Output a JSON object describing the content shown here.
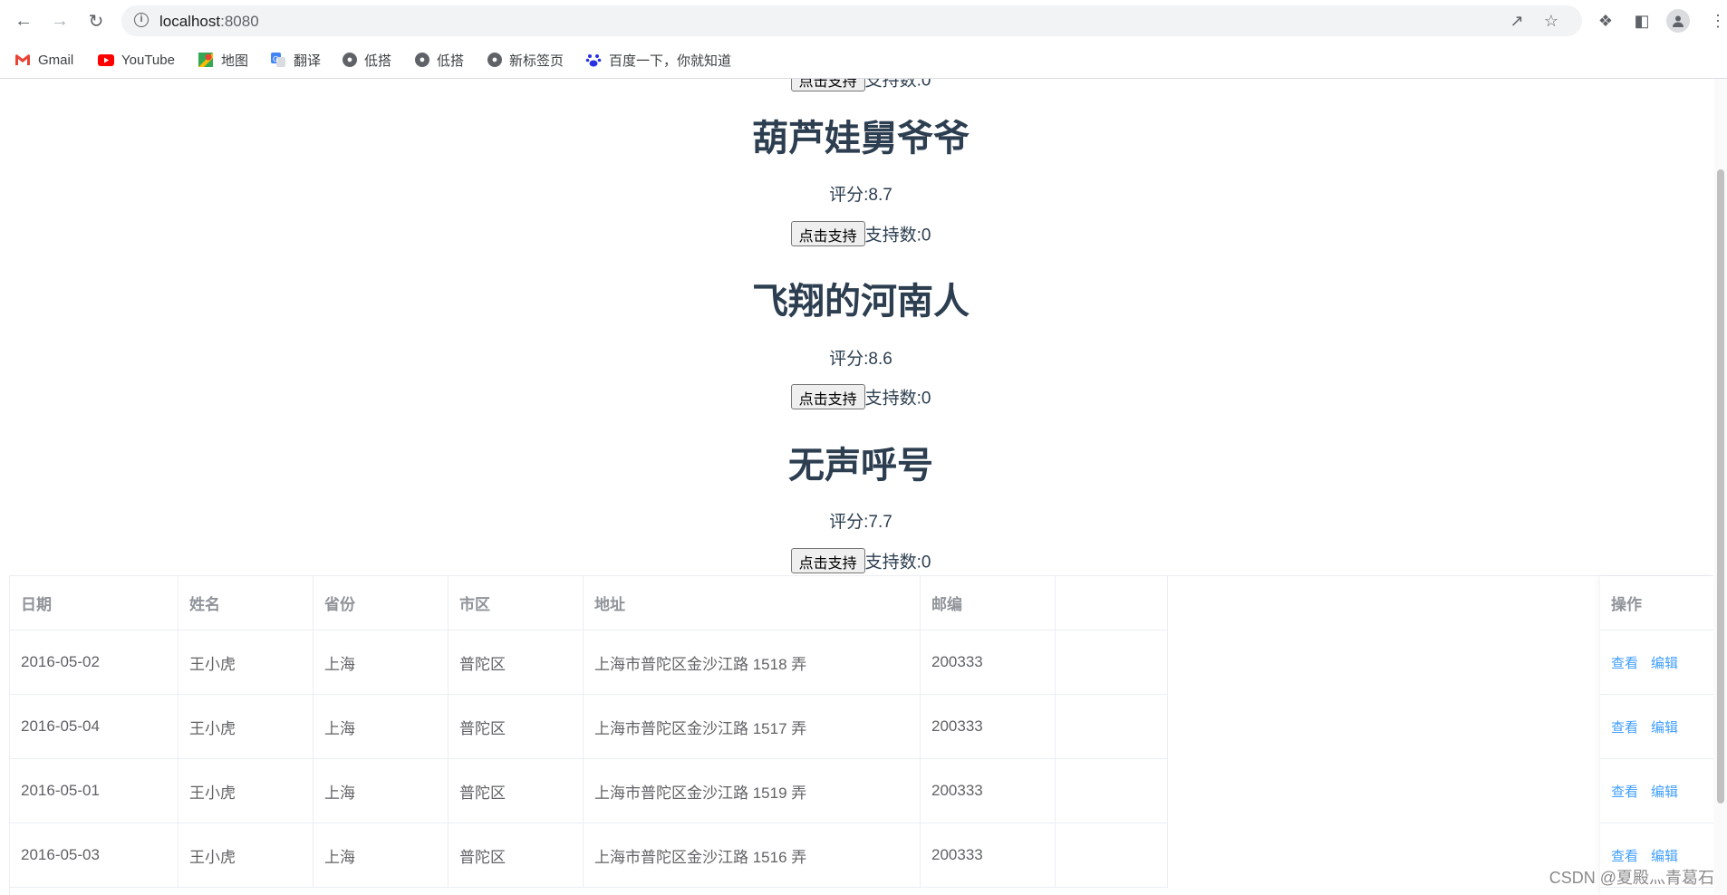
{
  "browser": {
    "url_host": "localhost",
    "url_port": ":8080",
    "bookmarks": [
      "Gmail",
      "YouTube",
      "地图",
      "翻译",
      "低搭",
      "低搭",
      "新标签页",
      "百度一下，你就知道"
    ]
  },
  "movies": [
    {
      "title": "葫芦娃舅爷爷",
      "rating": "评分:8.7",
      "button": "点击支持",
      "support": "支持数:0"
    },
    {
      "title": "飞翔的河南人",
      "rating": "评分:8.6",
      "button": "点击支持",
      "support": "支持数:0"
    },
    {
      "title": "无声呼号",
      "rating": "评分:7.7",
      "button": "点击支持",
      "support": "支持数:0"
    }
  ],
  "table": {
    "headers": [
      "日期",
      "姓名",
      "省份",
      "市区",
      "地址",
      "邮编",
      "",
      "操作"
    ],
    "rows": [
      [
        "2016-05-02",
        "王小虎",
        "上海",
        "普陀区",
        "上海市普陀区金沙江路 1518 弄",
        "200333"
      ],
      [
        "2016-05-04",
        "王小虎",
        "上海",
        "普陀区",
        "上海市普陀区金沙江路 1517 弄",
        "200333"
      ],
      [
        "2016-05-01",
        "王小虎",
        "上海",
        "普陀区",
        "上海市普陀区金沙江路 1519 弄",
        "200333"
      ],
      [
        "2016-05-03",
        "王小虎",
        "上海",
        "普陀区",
        "上海市普陀区金沙江路 1516 弄",
        "200333"
      ]
    ],
    "actions": {
      "view": "查看",
      "edit": "编辑"
    }
  },
  "watermark": "CSDN @夏殿灬青葛石",
  "colors": {
    "heading": "#2c3e50",
    "link": "#409eff",
    "table_text": "#606266",
    "table_header": "#909399"
  }
}
